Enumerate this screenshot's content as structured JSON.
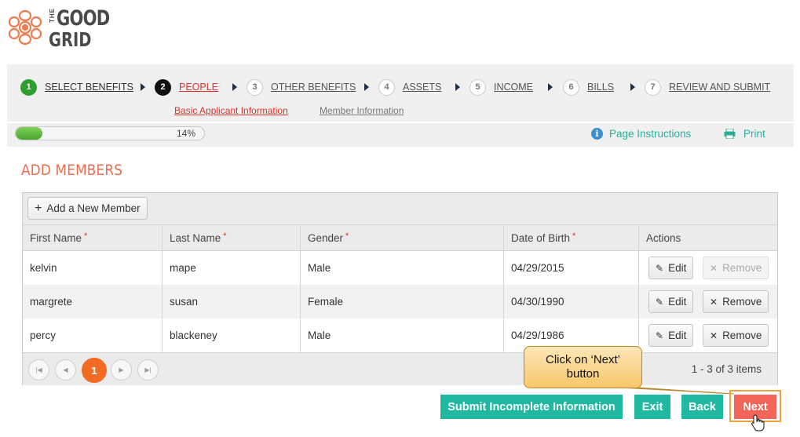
{
  "logo": {
    "the": "THE",
    "good": "GOOD",
    "grid": "GRID"
  },
  "steps": [
    {
      "number": "1",
      "label": "SELECT BENEFITS",
      "state": "done"
    },
    {
      "number": "2",
      "label": "PEOPLE",
      "state": "current"
    },
    {
      "number": "3",
      "label": "OTHER BENEFITS",
      "state": "todo"
    },
    {
      "number": "4",
      "label": "ASSETS",
      "state": "todo"
    },
    {
      "number": "5",
      "label": "INCOME",
      "state": "todo"
    },
    {
      "number": "6",
      "label": "BILLS",
      "state": "todo"
    },
    {
      "number": "7",
      "label": "REVIEW AND SUBMIT",
      "state": "todo"
    }
  ],
  "substeps": [
    {
      "label": "Basic Applicant Information",
      "state": "current"
    },
    {
      "label": "Member Information",
      "state": "todo"
    }
  ],
  "progress": {
    "value": 14,
    "text": "14%"
  },
  "page_instructions": "Page Instructions",
  "print": "Print",
  "heading": "ADD MEMBERS",
  "add_member": "Add a New Member",
  "columns": [
    {
      "label": "First Name",
      "required": "*"
    },
    {
      "label": "Last Name",
      "required": "*"
    },
    {
      "label": "Gender",
      "required": "*"
    },
    {
      "label": "Date of Birth",
      "required": "*"
    },
    {
      "label": "Actions",
      "required": ""
    }
  ],
  "rows": [
    {
      "first": "kelvin",
      "last": "mape",
      "gender": "Male",
      "dob": "04/29/2015",
      "edit": "Edit",
      "remove": "Remove",
      "remove_enabled": false
    },
    {
      "first": "margrete",
      "last": "susan",
      "gender": "Female",
      "dob": "04/30/1990",
      "edit": "Edit",
      "remove": "Remove",
      "remove_enabled": true
    },
    {
      "first": "percy",
      "last": "blackeney",
      "gender": "Male",
      "dob": "04/29/1986",
      "edit": "Edit",
      "remove": "Remove",
      "remove_enabled": true
    }
  ],
  "pager": {
    "current_page": "1",
    "info": "1 - 3 of 3 items"
  },
  "buttons": {
    "submit_incomplete": "Submit Incomplete Information",
    "exit": "Exit",
    "back": "Back",
    "next": "Next"
  },
  "callout": {
    "line1": "Click on ‘Next’",
    "line2": "button"
  },
  "colors": {
    "accent_teal": "#1fb9a2",
    "next_button": "#f3655a",
    "heading": "#ee6a4c",
    "step_done": "#2e9e2e",
    "step_current_label": "#d9342b",
    "page_current": "#f26b24"
  }
}
